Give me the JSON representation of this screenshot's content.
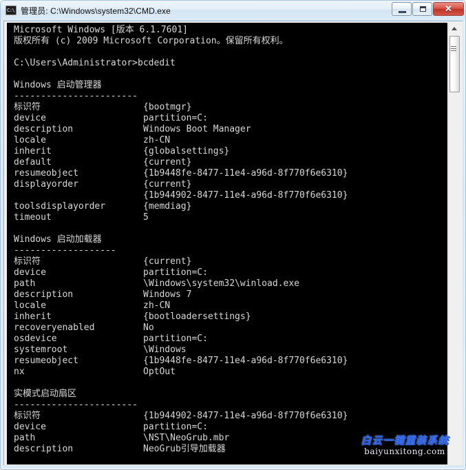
{
  "window": {
    "title": "管理员: C:\\Windows\\system32\\CMD.exe",
    "icon": "cmd-icon",
    "buttons": {
      "minimize": "–",
      "maximize": "□",
      "close": "✕"
    },
    "colors": {
      "frame": "#cfe0ef",
      "console_bg": "#000000",
      "console_fg": "#c0c0c0",
      "close_button": "#bd3427",
      "watermark": "#2b5fe0"
    }
  },
  "scrollbar": {
    "up_arrow": "scroll-up-arrow",
    "thumb": "scroll-thumb"
  },
  "console": {
    "lines": [
      {
        "text": "Microsoft Windows [版本 6.1.7601]"
      },
      {
        "text": "版权所有 (c) 2009 Microsoft Corporation。保留所有权利。"
      },
      {
        "text": ""
      },
      {
        "text": "C:\\Users\\Administrator>bcdedit"
      },
      {
        "text": ""
      },
      {
        "text": "Windows 启动管理器"
      },
      {
        "text": "-----------------------"
      },
      {
        "key": "标识符",
        "value": "{bootmgr}"
      },
      {
        "key": "device",
        "value": "partition=C:"
      },
      {
        "key": "description",
        "value": "Windows Boot Manager"
      },
      {
        "key": "locale",
        "value": "zh-CN"
      },
      {
        "key": "inherit",
        "value": "{globalsettings}"
      },
      {
        "key": "default",
        "value": "{current}"
      },
      {
        "key": "resumeobject",
        "value": "{1b9448fe-8477-11e4-a96d-8f770f6e6310}"
      },
      {
        "key": "displayorder",
        "value": "{current}"
      },
      {
        "key": "",
        "value": "{1b944902-8477-11e4-a96d-8f770f6e6310}"
      },
      {
        "key": "toolsdisplayorder",
        "value": "{memdiag}"
      },
      {
        "key": "timeout",
        "value": "5"
      },
      {
        "text": ""
      },
      {
        "text": "Windows 启动加载器"
      },
      {
        "text": "-------------------"
      },
      {
        "key": "标识符",
        "value": "{current}"
      },
      {
        "key": "device",
        "value": "partition=C:"
      },
      {
        "key": "path",
        "value": "\\Windows\\system32\\winload.exe"
      },
      {
        "key": "description",
        "value": "Windows 7"
      },
      {
        "key": "locale",
        "value": "zh-CN"
      },
      {
        "key": "inherit",
        "value": "{bootloadersettings}"
      },
      {
        "key": "recoveryenabled",
        "value": "No"
      },
      {
        "key": "osdevice",
        "value": "partition=C:"
      },
      {
        "key": "systemroot",
        "value": "\\Windows"
      },
      {
        "key": "resumeobject",
        "value": "{1b9448fe-8477-11e4-a96d-8f770f6e6310}"
      },
      {
        "key": "nx",
        "value": "OptOut"
      },
      {
        "text": ""
      },
      {
        "text": "实模式启动扇区"
      },
      {
        "text": "-----------------------"
      },
      {
        "key": "标识符",
        "value": "{1b944902-8477-11e4-a96d-8f770f6e6310}"
      },
      {
        "key": "device",
        "value": "partition=C:"
      },
      {
        "key": "path",
        "value": "\\NST\\NeoGrub.mbr"
      },
      {
        "key": "description",
        "value": "NeoGrub引导加载器"
      }
    ]
  },
  "watermark": {
    "chinese": "白云一键重装系统",
    "domain": "baiyunxitong.com"
  }
}
